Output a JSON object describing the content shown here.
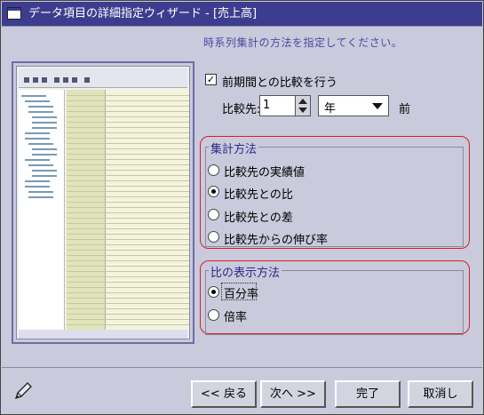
{
  "window": {
    "title": "データ項目の詳細指定ウィザード - [売上高]"
  },
  "instruction": "時系列集計の方法を指定してください。",
  "compare_prior": {
    "label": "前期間との比較を行う",
    "checked": "✓"
  },
  "compare_target": {
    "label": "比較先:",
    "value": "1",
    "unit": "年",
    "suffix": "前"
  },
  "aggregation": {
    "title": "集計方法",
    "options": [
      "比較先の実績値",
      "比較先との比",
      "比較先との差",
      "比較先からの伸び率"
    ],
    "selected_index": 1
  },
  "ratio_display": {
    "title": "比の表示方法",
    "options": [
      "百分率",
      "倍率"
    ],
    "selected_index": 0
  },
  "buttons": {
    "back": "<< 戻る",
    "next": "次へ >>",
    "finish": "完了",
    "cancel": "取消し"
  },
  "colors": {
    "titlebar": "#3d3d8f",
    "background": "#c9cadb",
    "highlight_border": "#d42020",
    "group_title": "#2a2a8a",
    "instruction_text": "#4a4aa6"
  },
  "icons": {
    "window": "window-icon",
    "pencil": "pencil-icon"
  }
}
